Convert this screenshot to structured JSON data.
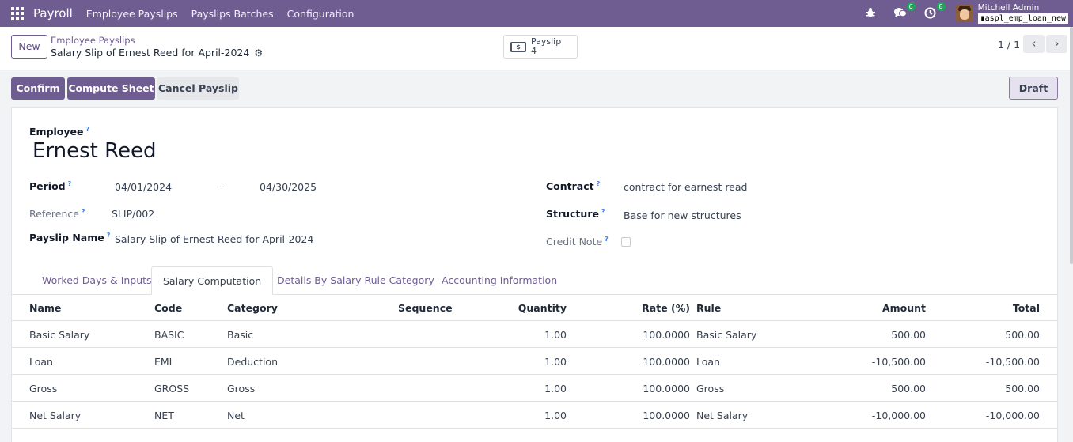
{
  "navbar": {
    "app_name": "Payroll",
    "menu": [
      "Employee Payslips",
      "Payslips Batches",
      "Configuration"
    ],
    "messages_count": "6",
    "activities_count": "8",
    "user_name": "Mitchell Admin",
    "database": "aspl_emp_loan_new"
  },
  "control": {
    "new_label": "New",
    "breadcrumb_parent": "Employee Payslips",
    "breadcrumb_current": "Salary Slip of Ernest Reed for April-2024",
    "smart_button_label": "Payslip",
    "smart_button_count": "4",
    "pager": "1 / 1"
  },
  "statusbar": {
    "confirm": "Confirm",
    "compute": "Compute Sheet",
    "cancel": "Cancel Payslip",
    "state": "Draft"
  },
  "form": {
    "employee_label": "Employee",
    "employee_name": "Ernest Reed",
    "period_label": "Period",
    "date_from": "04/01/2024",
    "date_sep": "-",
    "date_to": "04/30/2025",
    "reference_label": "Reference",
    "reference": "SLIP/002",
    "payslip_name_label": "Payslip Name",
    "payslip_name": "Salary Slip of Ernest Reed for April-2024",
    "contract_label": "Contract",
    "contract": "contract for earnest read",
    "structure_label": "Structure",
    "structure": "Base for new structures",
    "credit_note_label": "Credit Note"
  },
  "tabs": [
    "Worked Days & Inputs",
    "Salary Computation",
    "Details By Salary Rule Category",
    "Accounting Information"
  ],
  "table": {
    "headers": [
      "Name",
      "Code",
      "Category",
      "Sequence",
      "Quantity",
      "Rate (%)",
      "Rule",
      "Amount",
      "Total"
    ],
    "rows": [
      {
        "name": "Basic Salary",
        "code": "BASIC",
        "category": "Basic",
        "sequence": "",
        "quantity": "1.00",
        "rate": "100.0000",
        "rule": "Basic Salary",
        "amount": "500.00",
        "total": "500.00"
      },
      {
        "name": "Loan",
        "code": "EMI",
        "category": "Deduction",
        "sequence": "",
        "quantity": "1.00",
        "rate": "100.0000",
        "rule": "Loan",
        "amount": "-10,500.00",
        "total": "-10,500.00"
      },
      {
        "name": "Gross",
        "code": "GROSS",
        "category": "Gross",
        "sequence": "",
        "quantity": "1.00",
        "rate": "100.0000",
        "rule": "Gross",
        "amount": "500.00",
        "total": "500.00"
      },
      {
        "name": "Net Salary",
        "code": "NET",
        "category": "Net",
        "sequence": "",
        "quantity": "1.00",
        "rate": "100.0000",
        "rule": "Net Salary",
        "amount": "-10,000.00",
        "total": "-10,000.00"
      }
    ]
  },
  "colors": {
    "brand": "#6f5d91",
    "badge": "#21a55a",
    "help": "#3b82f6"
  }
}
